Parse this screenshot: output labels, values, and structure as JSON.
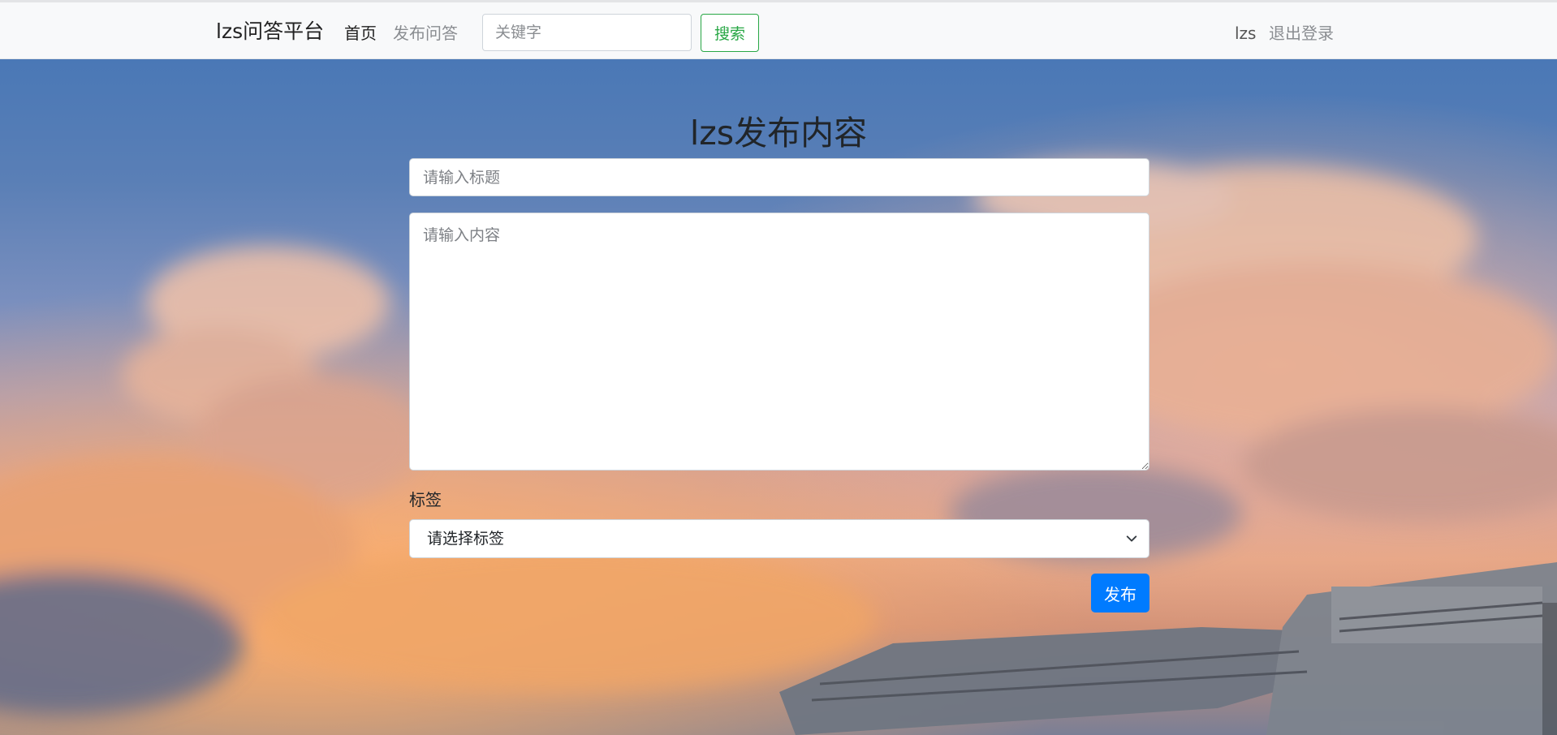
{
  "navbar": {
    "brand": "lzs问答平台",
    "nav_home": "首页",
    "nav_publish": "发布问答",
    "search_placeholder": "关键字",
    "search_button": "搜索",
    "username": "lzs",
    "logout": "退出登录"
  },
  "form": {
    "heading": "lzs发布内容",
    "title_placeholder": "请输入标题",
    "content_placeholder": "请输入内容",
    "tag_label": "标签",
    "tag_selected": "请选择标签",
    "submit_button": "发布"
  },
  "colors": {
    "navbar_bg": "#f8f9fa",
    "search_button": "#28a745",
    "submit_button": "#007bff"
  },
  "icons": {
    "tag_select": "chevron-down-icon"
  }
}
